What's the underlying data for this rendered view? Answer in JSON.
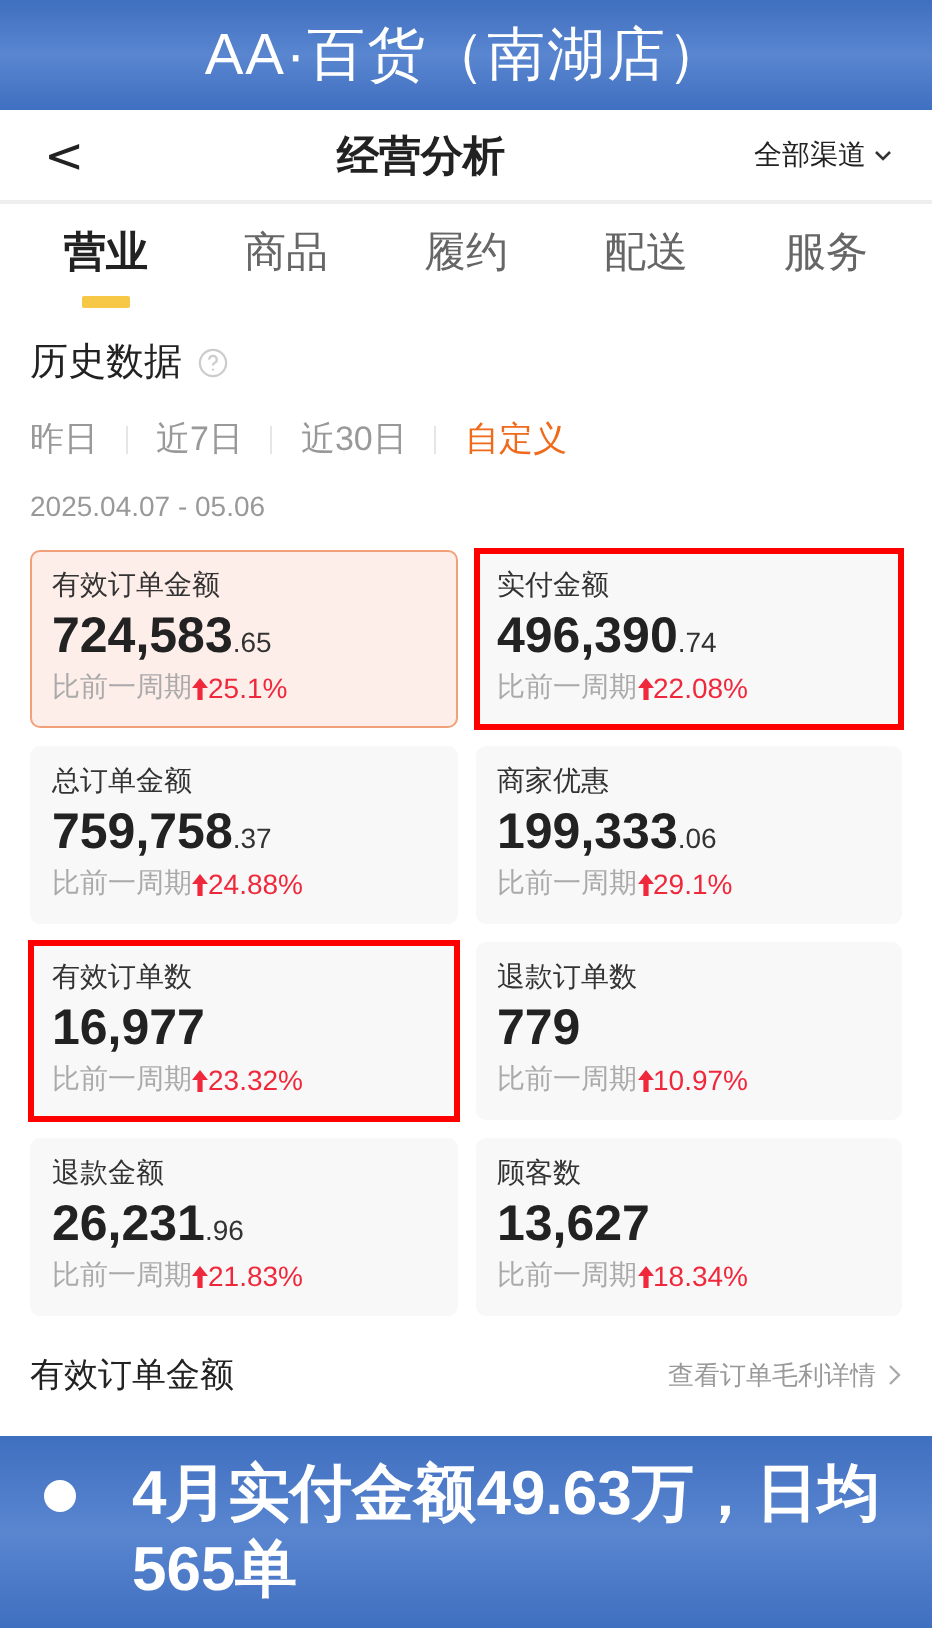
{
  "banner": {
    "title": "AA·百货（南湖店）"
  },
  "nav": {
    "back": "<",
    "title": "经营分析",
    "channel": "全部渠道"
  },
  "tabs": [
    {
      "label": "营业",
      "selected": true
    },
    {
      "label": "商品",
      "selected": false
    },
    {
      "label": "履约",
      "selected": false
    },
    {
      "label": "配送",
      "selected": false
    },
    {
      "label": "服务",
      "selected": false
    }
  ],
  "section": {
    "title": "历史数据"
  },
  "ranges": [
    {
      "label": "昨日",
      "selected": false
    },
    {
      "label": "近7日",
      "selected": false
    },
    {
      "label": "近30日",
      "selected": false
    },
    {
      "label": "自定义",
      "selected": true
    }
  ],
  "date_range": "2025.04.07 - 05.06",
  "metrics": [
    {
      "label": "有效订单金额",
      "value": "724,583",
      "decimal": ".65",
      "compare": "比前一周期",
      "change": "25.1%",
      "selected": true,
      "highlighted": false
    },
    {
      "label": "实付金额",
      "value": "496,390",
      "decimal": ".74",
      "compare": "比前一周期",
      "change": "22.08%",
      "selected": false,
      "highlighted": true
    },
    {
      "label": "总订单金额",
      "value": "759,758",
      "decimal": ".37",
      "compare": "比前一周期",
      "change": "24.88%",
      "selected": false,
      "highlighted": false
    },
    {
      "label": "商家优惠",
      "value": "199,333",
      "decimal": ".06",
      "compare": "比前一周期",
      "change": "29.1%",
      "selected": false,
      "highlighted": false
    },
    {
      "label": "有效订单数",
      "value": "16,977",
      "compare": "比前一周期",
      "change": "23.32%",
      "selected": false,
      "highlighted": true
    },
    {
      "label": "退款订单数",
      "value": "779",
      "compare": "比前一周期",
      "change": "10.97%",
      "selected": false,
      "highlighted": false
    },
    {
      "label": "退款金额",
      "value": "26,231",
      "decimal": ".96",
      "compare": "比前一周期",
      "change": "21.83%",
      "selected": false,
      "highlighted": false
    },
    {
      "label": "顾客数",
      "value": "13,627",
      "compare": "比前一周期",
      "change": "18.34%",
      "selected": false,
      "highlighted": false
    }
  ],
  "footer_row": {
    "title": "有效订单金额",
    "link": "查看订单毛利详情"
  },
  "caption": {
    "text": "4月实付金额49.63万，日均565单"
  }
}
